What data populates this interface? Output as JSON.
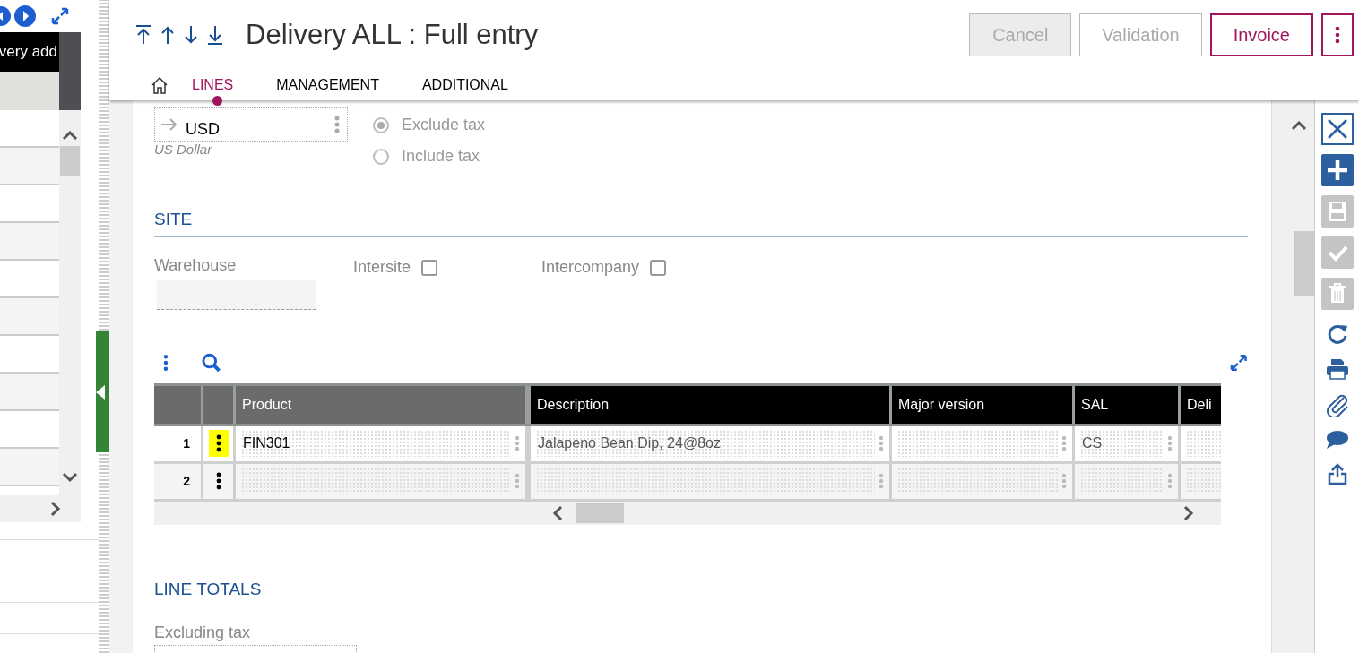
{
  "left_panel": {
    "column_header": "very add"
  },
  "header": {
    "title": "Delivery ALL : Full entry",
    "buttons": [
      {
        "label": "Cancel",
        "kind": "disabled"
      },
      {
        "label": "Validation",
        "kind": "outline"
      },
      {
        "label": "Invoice",
        "kind": "primary"
      }
    ],
    "tabs": [
      {
        "label": "LINES",
        "selected": true
      },
      {
        "label": "MANAGEMENT",
        "selected": false
      },
      {
        "label": "ADDITIONAL",
        "selected": false
      }
    ]
  },
  "currency": {
    "value": "USD",
    "description": "US Dollar"
  },
  "price_type": [
    {
      "label": "Exclude tax",
      "selected": true
    },
    {
      "label": "Include tax",
      "selected": false
    }
  ],
  "site": {
    "title": "SITE",
    "warehouse_label": "Warehouse",
    "checkboxes": [
      {
        "label": "Intersite",
        "checked": false
      },
      {
        "label": "Intercompany",
        "checked": false
      }
    ]
  },
  "grid": {
    "columns": [
      {
        "label": "Product",
        "frozen": true
      },
      {
        "label": "Description",
        "frozen": false
      },
      {
        "label": "Major version",
        "frozen": false
      },
      {
        "label": "SAL",
        "frozen": false
      },
      {
        "label": "Deli",
        "frozen": false
      }
    ],
    "rows": [
      {
        "number": "1",
        "highlighted": true,
        "cells": [
          "FIN301",
          "Jalapeno Bean Dip, 24@8oz",
          "",
          "CS",
          ""
        ]
      },
      {
        "number": "2",
        "highlighted": false,
        "cells": [
          "",
          "",
          "",
          "",
          ""
        ]
      }
    ]
  },
  "line_totals": {
    "title": "LINE TOTALS",
    "field_label": "Excluding tax"
  }
}
